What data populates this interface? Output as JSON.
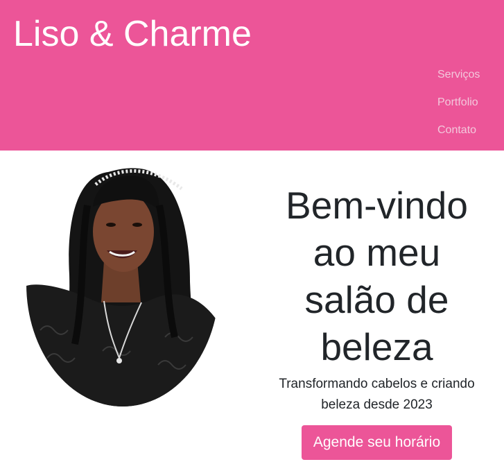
{
  "colors": {
    "brand": "#ec5598",
    "nav_text": "#f3c8dc",
    "heading_text": "#212529"
  },
  "header": {
    "brand_name": "Liso & Charme",
    "nav": [
      {
        "label": "Serviços"
      },
      {
        "label": "Portfolio"
      },
      {
        "label": "Contato"
      }
    ]
  },
  "hero": {
    "photo_icon": "profile-photo",
    "title": "Bem-vindo ao meu salão de beleza",
    "subtitle": "Transformando cabelos e criando beleza desde 2023",
    "cta_label": "Agende seu horário"
  }
}
